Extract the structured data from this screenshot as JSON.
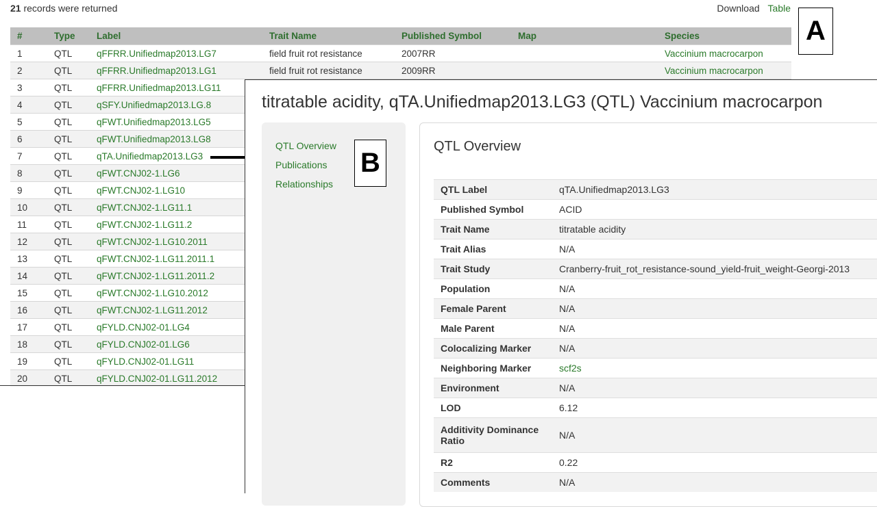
{
  "records": {
    "count": "21",
    "text": " records were returned"
  },
  "top_links": {
    "download": "Download",
    "table": "Table"
  },
  "labels": {
    "a": "A",
    "b": "B"
  },
  "table": {
    "headers": [
      "#",
      "Type",
      "Label",
      "Trait Name",
      "Published Symbol",
      "Map",
      "Species"
    ],
    "rows": [
      [
        "1",
        "QTL",
        "qFFRR.Unifiedmap2013.LG7",
        "field fruit rot resistance",
        "2007RR",
        "",
        "Vaccinium macrocarpon"
      ],
      [
        "2",
        "QTL",
        "qFFRR.Unifiedmap2013.LG1",
        "field fruit rot resistance",
        "2009RR",
        "",
        "Vaccinium macrocarpon"
      ],
      [
        "3",
        "QTL",
        "qFFRR.Unifiedmap2013.LG11",
        "",
        "",
        "",
        ""
      ],
      [
        "4",
        "QTL",
        "qSFY.Unifiedmap2013.LG.8",
        "",
        "",
        "",
        ""
      ],
      [
        "5",
        "QTL",
        "qFWT.Unifiedmap2013.LG5",
        "",
        "",
        "",
        ""
      ],
      [
        "6",
        "QTL",
        "qFWT.Unifiedmap2013.LG8",
        "",
        "",
        "",
        ""
      ],
      [
        "7",
        "QTL",
        "qTA.Unifiedmap2013.LG3",
        "",
        "",
        "",
        ""
      ],
      [
        "8",
        "QTL",
        "qFWT.CNJ02-1.LG6",
        "",
        "",
        "",
        ""
      ],
      [
        "9",
        "QTL",
        "qFWT.CNJ02-1.LG10",
        "",
        "",
        "",
        ""
      ],
      [
        "10",
        "QTL",
        "qFWT.CNJ02-1.LG11.1",
        "",
        "",
        "",
        ""
      ],
      [
        "11",
        "QTL",
        "qFWT.CNJ02-1.LG11.2",
        "",
        "",
        "",
        ""
      ],
      [
        "12",
        "QTL",
        "qFWT.CNJ02-1.LG10.2011",
        "",
        "",
        "",
        ""
      ],
      [
        "13",
        "QTL",
        "qFWT.CNJ02-1.LG11.2011.1",
        "",
        "",
        "",
        ""
      ],
      [
        "14",
        "QTL",
        "qFWT.CNJ02-1.LG11.2011.2",
        "",
        "",
        "",
        ""
      ],
      [
        "15",
        "QTL",
        "qFWT.CNJ02-1.LG10.2012",
        "",
        "",
        "",
        ""
      ],
      [
        "16",
        "QTL",
        "qFWT.CNJ02-1.LG11.2012",
        "",
        "",
        "",
        ""
      ],
      [
        "17",
        "QTL",
        "qFYLD.CNJ02-01.LG4",
        "",
        "",
        "",
        ""
      ],
      [
        "18",
        "QTL",
        "qFYLD.CNJ02-01.LG6",
        "",
        "",
        "",
        ""
      ],
      [
        "19",
        "QTL",
        "qFYLD.CNJ02-01.LG11",
        "",
        "",
        "",
        ""
      ],
      [
        "20",
        "QTL",
        "qFYLD.CNJ02-01.LG11.2012",
        "",
        "",
        "",
        ""
      ]
    ]
  },
  "detail": {
    "title": "titratable acidity, qTA.Unifiedmap2013.LG3 (QTL) Vaccinium macrocarpon",
    "sidebar": [
      "QTL Overview",
      "Publications",
      "Relationships"
    ],
    "section_title": "QTL Overview",
    "fields": [
      {
        "key": "QTL Label",
        "value": "qTA.Unifiedmap2013.LG3"
      },
      {
        "key": "Published Symbol",
        "value": "ACID"
      },
      {
        "key": "Trait Name",
        "value": "titratable acidity"
      },
      {
        "key": "Trait Alias",
        "value": "N/A"
      },
      {
        "key": "Trait Study",
        "value": "Cranberry-fruit_rot_resistance-sound_yield-fruit_weight-Georgi-2013"
      },
      {
        "key": "Population",
        "value": "N/A"
      },
      {
        "key": "Female Parent",
        "value": "N/A"
      },
      {
        "key": "Male Parent",
        "value": "N/A"
      },
      {
        "key": "Colocalizing Marker",
        "value": "N/A"
      },
      {
        "key": "Neighboring Marker",
        "value": "scf2s"
      },
      {
        "key": "Environment",
        "value": "N/A"
      },
      {
        "key": "LOD",
        "value": "6.12"
      },
      {
        "key": "Additivity Dominance Ratio",
        "value": "N/A"
      },
      {
        "key": "R2",
        "value": "0.22"
      },
      {
        "key": "Comments",
        "value": "N/A"
      }
    ]
  },
  "colors": {
    "link_green": "#2a7a2a",
    "header_grey": "#bfbfbf"
  }
}
